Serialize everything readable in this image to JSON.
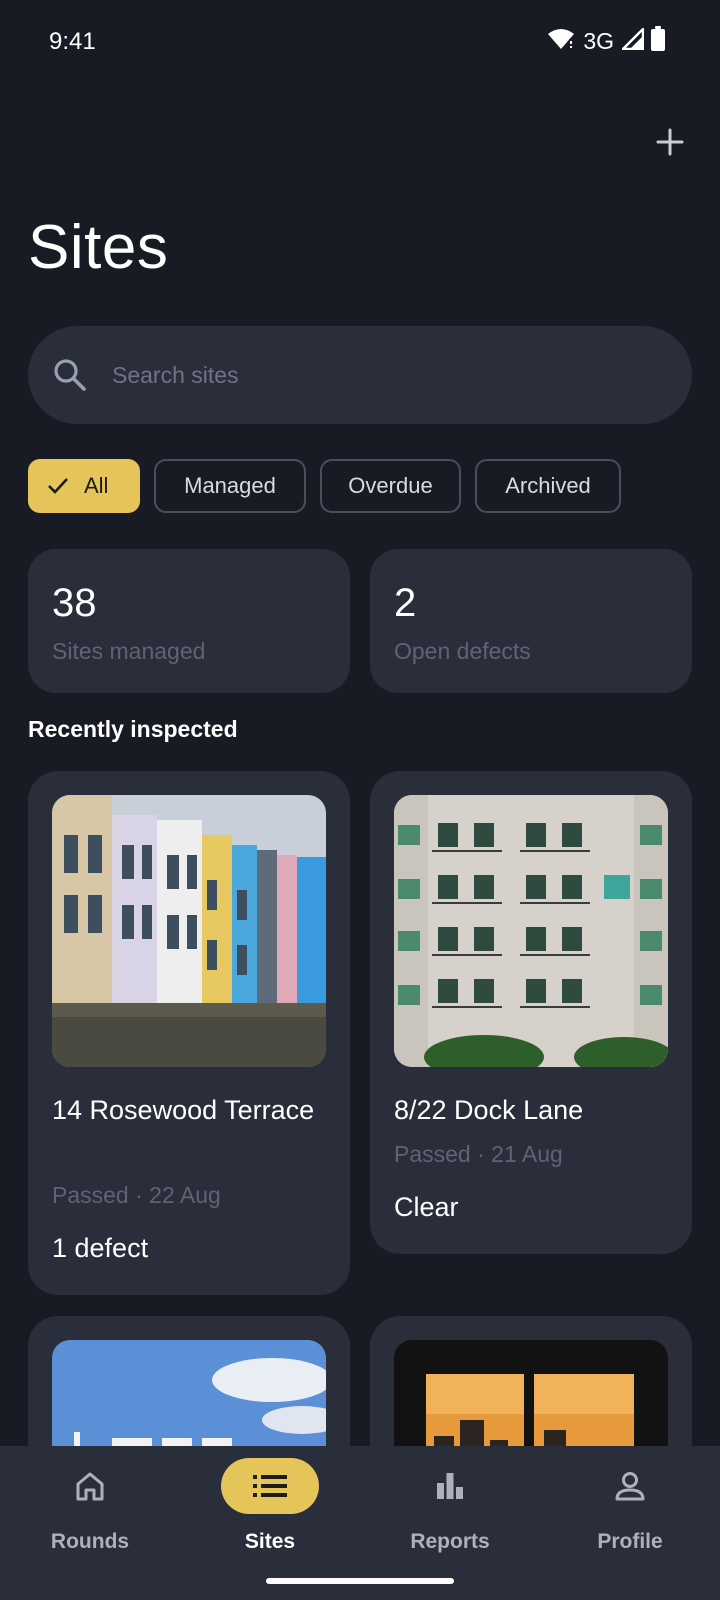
{
  "status": {
    "time": "9:41",
    "network": "3G"
  },
  "header": {
    "title": "Sites"
  },
  "search": {
    "placeholder": "Search sites",
    "value": ""
  },
  "filters": [
    {
      "label": "All",
      "selected": true
    },
    {
      "label": "Managed",
      "selected": false
    },
    {
      "label": "Overdue",
      "selected": false
    },
    {
      "label": "Archived",
      "selected": false
    }
  ],
  "stats": [
    {
      "value": "38",
      "label": "Sites managed"
    },
    {
      "value": "2",
      "label": "Open defects"
    }
  ],
  "section": {
    "title": "Recently inspected"
  },
  "sites": [
    {
      "name": "14 Rosewood Terrace",
      "status": "Passed · 22 Aug",
      "defects": "1 defect"
    },
    {
      "name": "8/22 Dock Lane",
      "status": "Passed · 21 Aug",
      "defects": "Clear"
    }
  ],
  "nav": [
    {
      "label": "Rounds",
      "icon": "home-icon",
      "active": false
    },
    {
      "label": "Sites",
      "icon": "list-icon",
      "active": true
    },
    {
      "label": "Reports",
      "icon": "bar-chart-icon",
      "active": false
    },
    {
      "label": "Profile",
      "icon": "person-icon",
      "active": false
    }
  ],
  "colors": {
    "background": "#191b24",
    "surface": "#2a2d3a",
    "accent": "#e5c45a",
    "muted_text": "#5f6374"
  }
}
